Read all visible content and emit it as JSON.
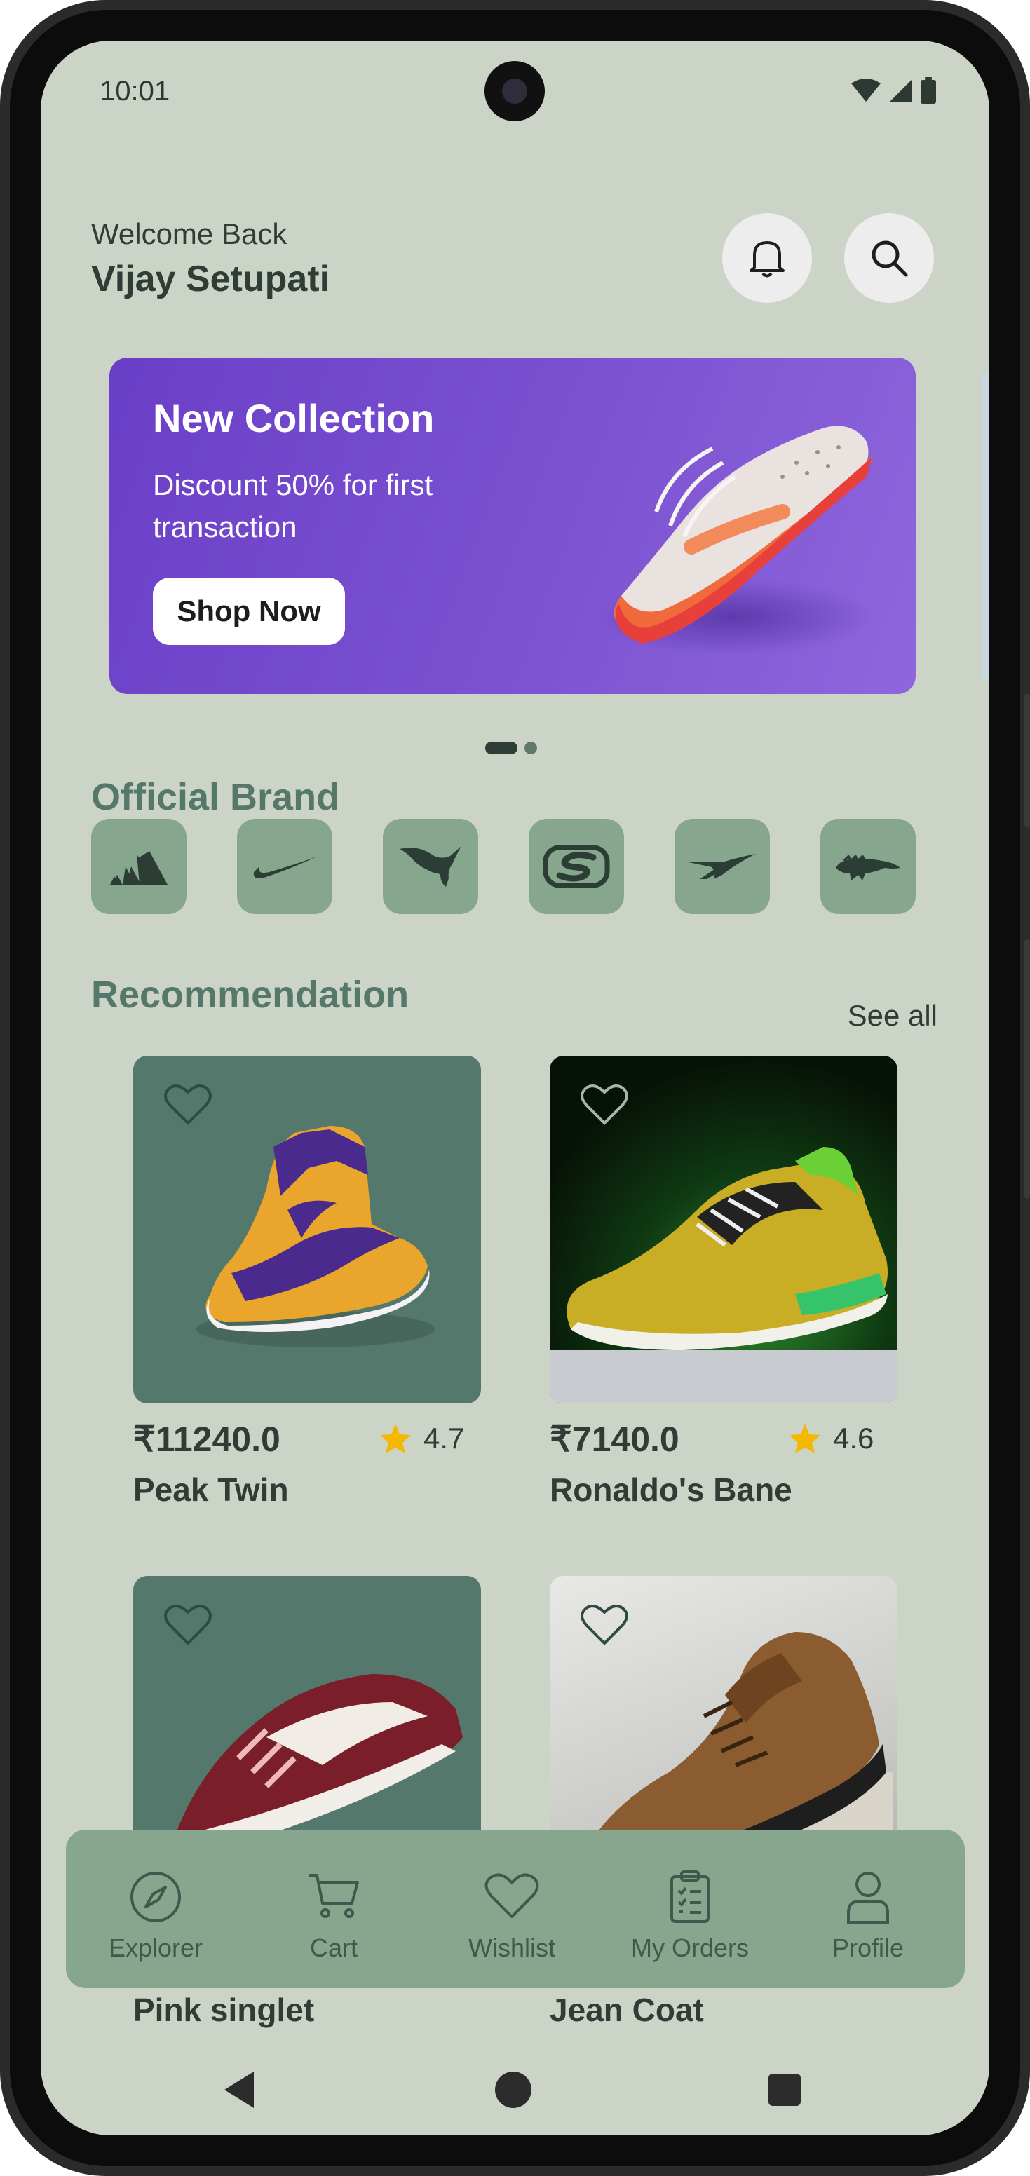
{
  "status": {
    "time": "10:01"
  },
  "header": {
    "welcome": "Welcome Back",
    "user_name": "Vijay Setupati"
  },
  "banner": {
    "title": "New Collection",
    "subtitle": "Discount 50% for first transaction",
    "button": "Shop Now",
    "gradient": [
      "#6a3fc7",
      "#8f66dc"
    ]
  },
  "carousel": {
    "active_index": 0,
    "count": 2
  },
  "brands": {
    "title": "Official Brand",
    "items": [
      "adidas-logo",
      "nike-logo",
      "puma-logo",
      "skechers-logo",
      "reebok-logo",
      "lacoste-logo"
    ]
  },
  "recommendation": {
    "title": "Recommendation",
    "see_all": "See all",
    "products": [
      {
        "name": "Peak Twin",
        "price": "₹11240.0",
        "rating": "4.7"
      },
      {
        "name": "Ronaldo's Bane",
        "price": "₹7140.0",
        "rating": "4.6"
      },
      {
        "name": "Pink singlet"
      },
      {
        "name": "Jean Coat"
      }
    ]
  },
  "nav": {
    "items": [
      {
        "label": "Explorer",
        "icon": "compass-icon"
      },
      {
        "label": "Cart",
        "icon": "cart-icon"
      },
      {
        "label": "Wishlist",
        "icon": "heart-icon"
      },
      {
        "label": "My Orders",
        "icon": "clipboard-icon"
      },
      {
        "label": "Profile",
        "icon": "user-icon"
      }
    ]
  },
  "colors": {
    "background": "#ccd3c7",
    "accent": "#86a78e",
    "text": "#2f3d36",
    "heading": "#55786a",
    "star": "#f5b800"
  }
}
